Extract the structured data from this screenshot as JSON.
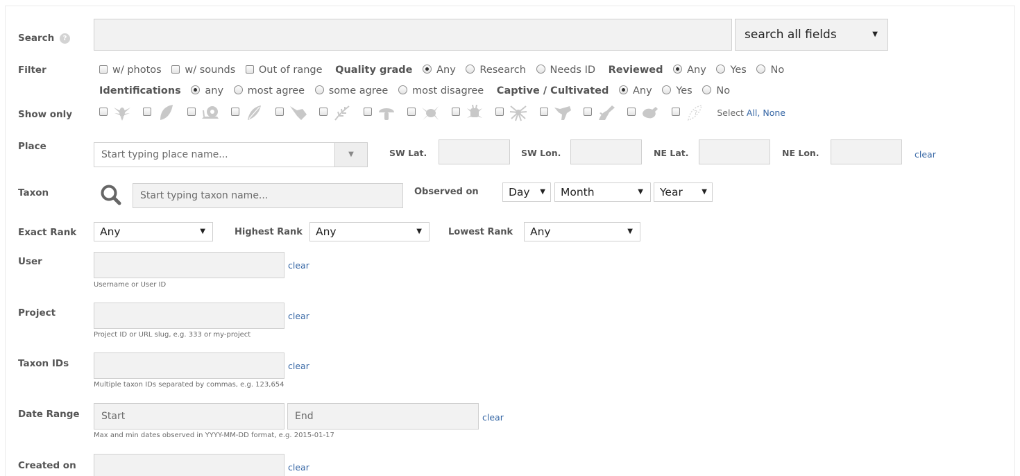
{
  "search": {
    "label": "Search",
    "help_icon": "question-circle-icon",
    "value": "",
    "scope_select": "search all fields"
  },
  "filter": {
    "label": "Filter",
    "checkboxes": [
      "w/ photos",
      "w/ sounds",
      "Out of range"
    ],
    "quality_grade": {
      "label": "Quality grade",
      "options": [
        "Any",
        "Research",
        "Needs ID"
      ],
      "selected": "Any"
    },
    "reviewed": {
      "label": "Reviewed",
      "options": [
        "Any",
        "Yes",
        "No"
      ],
      "selected": "Any"
    },
    "identifications": {
      "label": "Identifications",
      "options": [
        "any",
        "most agree",
        "some agree",
        "most disagree"
      ],
      "selected": "any"
    },
    "captive": {
      "label": "Captive / Cultivated",
      "options": [
        "Any",
        "Yes",
        "No"
      ],
      "selected": "Any"
    }
  },
  "show_only": {
    "label": "Show only",
    "icons": [
      "bird-icon",
      "leaf-icon",
      "snail-icon",
      "fern-leaf-icon",
      "fish-icon",
      "plant-icon",
      "mushroom-icon",
      "amphibian-icon",
      "bug-icon",
      "spider-icon",
      "mammal-icon",
      "reptile-icon",
      "protozoa-icon",
      "unknown-icon"
    ],
    "select_label": "Select",
    "all_link": "All,",
    "none_link": "None"
  },
  "place": {
    "label": "Place",
    "placeholder": "Start typing place name...",
    "sw_lat": "SW Lat.",
    "sw_lon": "SW Lon.",
    "ne_lat": "NE Lat.",
    "ne_lon": "NE Lon.",
    "clear": "clear"
  },
  "taxon": {
    "label": "Taxon",
    "placeholder": "Start typing taxon name...",
    "observed_on": "Observed on",
    "day": "Day",
    "month": "Month",
    "year": "Year"
  },
  "rank": {
    "exact_label": "Exact Rank",
    "exact_value": "Any",
    "highest_label": "Highest Rank",
    "highest_value": "Any",
    "lowest_label": "Lowest Rank",
    "lowest_value": "Any"
  },
  "user": {
    "label": "User",
    "clear": "clear",
    "help": "Username or User ID"
  },
  "project": {
    "label": "Project",
    "clear": "clear",
    "help": "Project ID or URL slug, e.g. 333 or my-project"
  },
  "taxon_ids": {
    "label": "Taxon IDs",
    "clear": "clear",
    "help": "Multiple taxon IDs separated by commas, e.g. 123,654"
  },
  "date_range": {
    "label": "Date Range",
    "start": "Start",
    "end": "End",
    "clear": "clear",
    "help": "Max and min dates observed in YYYY-MM-DD format, e.g. 2015-01-17"
  },
  "created_on": {
    "label": "Created on",
    "clear": "clear"
  }
}
